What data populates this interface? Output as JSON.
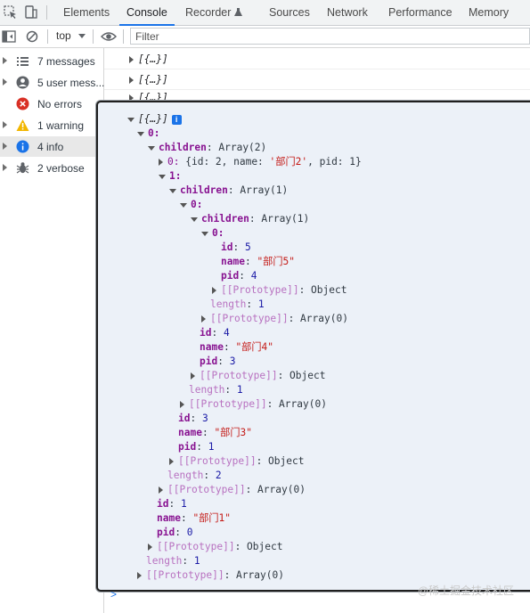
{
  "tabs": [
    {
      "label": "Elements"
    },
    {
      "label": "Console"
    },
    {
      "label": "Recorder"
    },
    {
      "label": "Sources"
    },
    {
      "label": "Network"
    },
    {
      "label": "Performance"
    },
    {
      "label": "Memory"
    }
  ],
  "toolbar": {
    "context": "top",
    "filter_placeholder": "Filter"
  },
  "sidebar": [
    {
      "label": "7 messages",
      "icon": "list-icon"
    },
    {
      "label": "5 user mess...",
      "icon": "user-icon"
    },
    {
      "label": "No errors",
      "icon": "error-icon"
    },
    {
      "label": "1 warning",
      "icon": "warning-icon"
    },
    {
      "label": "4 info",
      "icon": "info-icon"
    },
    {
      "label": "2 verbose",
      "icon": "bug-icon"
    }
  ],
  "logs": [
    "[{…}]",
    "[{…}]",
    "[{…}]"
  ],
  "tree": {
    "root": "[{…}]",
    "l_0": "0:",
    "children": "children",
    "array2": "Array(2)",
    "array1": "Array(1)",
    "array0": "Array(0)",
    "zero": "0:",
    "one": "1:",
    "item0_summary_pre": "{id: 2, name: ",
    "item0_summary_name": "'部门2'",
    "item0_summary_post": ", pid: 1}",
    "id": "id",
    "name": "name",
    "pid": "pid",
    "length": "length",
    "proto": "[[Prototype]]",
    "object": "Object",
    "n5": {
      "id": "5",
      "name": "\"部门5\"",
      "pid": "4"
    },
    "n4": {
      "id": "4",
      "name": "\"部门4\"",
      "pid": "3"
    },
    "n3": {
      "id": "3",
      "name": "\"部门3\"",
      "pid": "1"
    },
    "n1": {
      "id": "1",
      "name": "\"部门1\"",
      "pid": "0"
    },
    "len1": "1",
    "len2": "2"
  },
  "prompt": ">",
  "watermark": "@稀土掘金技术社区"
}
